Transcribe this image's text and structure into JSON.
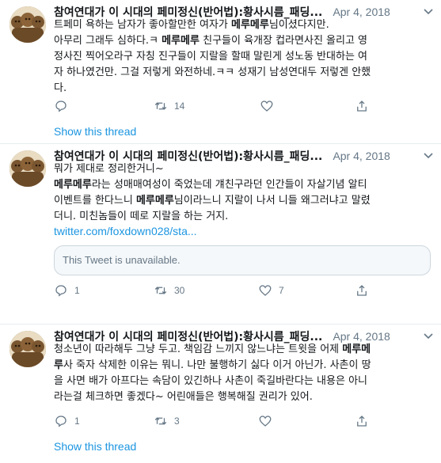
{
  "colors": {
    "link": "#1b95e0",
    "muted": "#657786",
    "divider": "#e6ecf0"
  },
  "tweets": [
    {
      "author": "참여연대가 이 시대의 페미정신(반어법):황사시름_패딩...",
      "date": "Apr 4, 2018",
      "lines": [
        [
          {
            "t": "트페미 욕하는 남자가 좋아할만한 여자가 "
          },
          {
            "t": "메루메루",
            "b": true
          },
          {
            "t": "님이셨다지만."
          }
        ],
        [
          {
            "t": "아무리 그래두 심하다.ㅋ "
          },
          {
            "t": "메루메루",
            "b": true
          },
          {
            "t": " 친구들이 육개장 컵라면사진 올리고 영"
          }
        ],
        [
          {
            "t": "정사진 찍어오라구 자칭 진구들이 지랄을 할때 말린게 성노동 반대하는 여"
          }
        ],
        [
          {
            "t": "자 하나였건만. 그걸 저렇게 와전하네.ㅋㅋ 성재기 남성연대두 저렇겐 안했"
          }
        ],
        [
          {
            "t": "다."
          }
        ]
      ],
      "actions": {
        "reply": "",
        "retweet": "14",
        "like": "",
        "share": ""
      },
      "show_thread": "Show this thread"
    },
    {
      "author": "참여연대가 이 시대의 페미정신(반어법):황사시름_패딩...",
      "date": "Apr 4, 2018",
      "lines": [
        [
          {
            "t": "뭐가 제대로 정리한거니~"
          }
        ],
        [
          {
            "t": "메루메루",
            "b": true
          },
          {
            "t": "라는 성매매여성이 죽었는데 걔친구라던 인간들이 자살기념 알티"
          }
        ],
        [
          {
            "t": "이벤트를 한다느니 "
          },
          {
            "t": "메루메루",
            "b": true
          },
          {
            "t": "님이라느니 지랄이 나서 니들 왜그러냐고 말렸"
          }
        ],
        [
          {
            "t": "더니. 미친놈들이 떼로 지랄을 하는 거지."
          }
        ]
      ],
      "link": "twitter.com/foxdown028/sta...",
      "quote": "This Tweet is unavailable.",
      "actions": {
        "reply": "1",
        "retweet": "30",
        "like": "7",
        "share": ""
      }
    },
    {
      "author": "참여연대가 이 시대의 페미정신(반어법):황사시름_패딩...",
      "date": "Apr 4, 2018",
      "lines": [
        [
          {
            "t": "청소년이 따라해두 그냥 두고. 책임감 느끼지 않느냐는 트윗을 어제 "
          },
          {
            "t": "메루메",
            "b": true
          }
        ],
        [
          {
            "t": "루",
            "b": true
          },
          {
            "t": "사 죽자 삭제한 이유는 뭐니. 나만 불행하기 싫다 이거 아닌가. 사촌이 땅"
          }
        ],
        [
          {
            "t": "을 사면 배가 아프다는 속담이 있긴하나 사촌이 죽길바란다는 내용은 아니"
          }
        ],
        [
          {
            "t": "라는걸 체크하면 좋겠다~ 어린애들은 행복해질 권리가 있어."
          }
        ]
      ],
      "actions": {
        "reply": "1",
        "retweet": "3",
        "like": "",
        "share": ""
      },
      "show_thread": "Show this thread"
    }
  ]
}
